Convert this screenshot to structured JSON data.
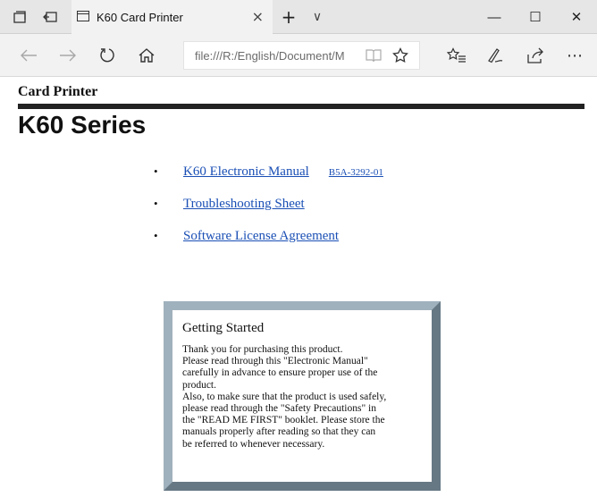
{
  "browser": {
    "tab_title": "K60 Card Printer",
    "tab_close": "×",
    "new_tab": "+",
    "tab_list": "∨",
    "address": "file:///R:/English/Document/M",
    "win_min": "—",
    "win_max": "☐",
    "win_close": "✕"
  },
  "page": {
    "brand": "Card Printer",
    "series": "K60 Series",
    "links": [
      {
        "label": "K60 Electronic Manual",
        "code": "B5A-3292-01"
      },
      {
        "label": "Troubleshooting Sheet"
      },
      {
        "label": "Software License Agreement"
      }
    ],
    "getting_started": {
      "title": "Getting Started",
      "lines": [
        "Thank you for purchasing this product.",
        "Please read through this \"Electronic Manual\"",
        "carefully in advance to ensure proper use of the",
        "product.",
        "Also, to make sure that the product is used safely,",
        "please read through the \"Safety Precautions\" in",
        "the \"READ ME FIRST\" booklet. Please store the",
        "manuals properly after reading so that they can",
        "be referred to whenever necessary."
      ]
    }
  },
  "colors": {
    "link": "#1a4fb5",
    "frame": "#7d8f9b"
  }
}
